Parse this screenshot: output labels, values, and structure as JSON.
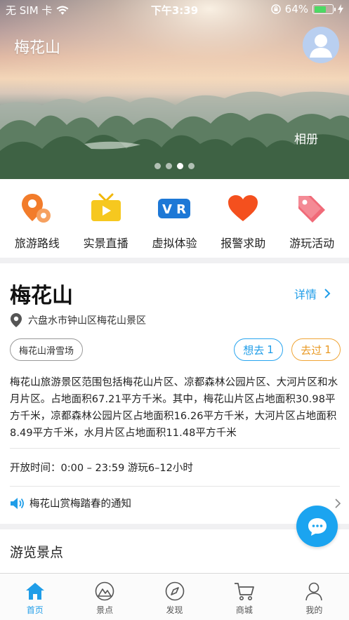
{
  "status_bar": {
    "carrier": "无 SIM 卡",
    "time": "下午3:39",
    "battery_percent": "64%",
    "battery_level": 0.64
  },
  "hero": {
    "title": "梅花山",
    "album_label": "相册",
    "carousel_count": 4,
    "carousel_active_index": 2
  },
  "quick_menu": [
    {
      "label": "旅游路线",
      "icon": "route-map-pin-icon"
    },
    {
      "label": "实景直播",
      "icon": "live-tv-icon"
    },
    {
      "label": "虚拟体验",
      "icon": "vr-icon"
    },
    {
      "label": "报警求助",
      "icon": "heart-icon"
    },
    {
      "label": "游玩活动",
      "icon": "tag-icon"
    }
  ],
  "info": {
    "title": "梅花山",
    "detail_label": "详情",
    "address": "六盘水市钟山区梅花山景区",
    "tag": "梅花山滑雪场",
    "want_label": "想去",
    "want_count": "1",
    "been_label": "去过",
    "been_count": "1",
    "description": "梅花山旅游景区范围包括梅花山片区、凉都森林公园片区、大河片区和水月片区。占地面积67.21平方千米。其中，梅花山片区占地面积30.98平方千米，凉都森林公园片区占地面积16.26平方千米，大河片区占地面积8.49平方千米，水月片区占地面积11.48平方千米",
    "hours": "开放时间：0:00 – 23:59 游玩6–12小时",
    "notice": "梅花山赏梅踏春的通知"
  },
  "section": {
    "title": "游览景点"
  },
  "tabbar": [
    {
      "label": "首页",
      "icon": "home-icon",
      "active": true
    },
    {
      "label": "景点",
      "icon": "mountain-icon",
      "active": false
    },
    {
      "label": "发现",
      "icon": "compass-icon",
      "active": false
    },
    {
      "label": "商城",
      "icon": "cart-icon",
      "active": false
    },
    {
      "label": "我的",
      "icon": "user-icon",
      "active": false
    }
  ],
  "colors": {
    "accent": "#1f9de8",
    "orange": "#e99a25",
    "battery": "#4cd964"
  }
}
